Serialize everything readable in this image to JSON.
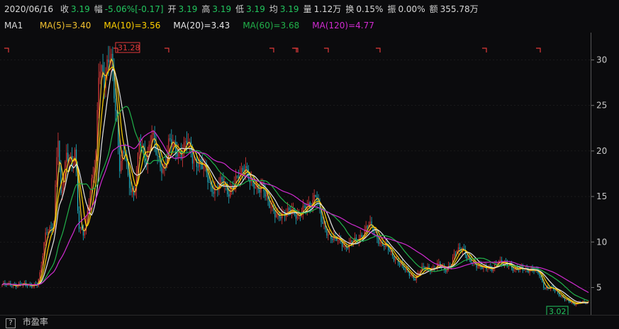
{
  "header": {
    "date": "2020/06/16",
    "items": [
      {
        "label": "收",
        "value": "3.19",
        "color": "#22c55e"
      },
      {
        "label": "幅",
        "value": "-5.06%[-0.17]",
        "color": "#22c55e"
      },
      {
        "label": "开",
        "value": "3.19",
        "color": "#22c55e"
      },
      {
        "label": "高",
        "value": "3.19",
        "color": "#22c55e"
      },
      {
        "label": "低",
        "value": "3.19",
        "color": "#22c55e"
      },
      {
        "label": "均",
        "value": "3.19",
        "color": "#22c55e"
      },
      {
        "label": "量",
        "value": "1.12万",
        "color": "#d8d8d8"
      },
      {
        "label": "换",
        "value": "0.15%",
        "color": "#d8d8d8"
      },
      {
        "label": "振",
        "value": "0.00%",
        "color": "#d8d8d8"
      },
      {
        "label": "额",
        "value": "355.78万",
        "color": "#d8d8d8"
      }
    ]
  },
  "ma_bar": {
    "title": "MA1",
    "entries": [
      {
        "text": "MA(5)=3.40",
        "color": "#f2c230"
      },
      {
        "text": "MA(10)=3.56",
        "color": "#ffd000"
      },
      {
        "text": "MA(20)=3.43",
        "color": "#e6e6e6"
      },
      {
        "text": "MA(60)=3.68",
        "color": "#21b14a"
      },
      {
        "text": "MA(120)=4.77",
        "color": "#d12bd1"
      }
    ]
  },
  "bottom_bar": {
    "help_icon": "question-icon",
    "label": "市盈率"
  },
  "colors": {
    "background": "#0b0b0d",
    "up": "#e33b3b",
    "down": "#21b6c8",
    "grid": "#2a2a2a"
  },
  "chart_data": {
    "type": "line",
    "ylim": [
      2,
      33
    ],
    "yticks": [
      5,
      10,
      15,
      20,
      25,
      30
    ],
    "annotations": [
      {
        "text": "31.28",
        "kind": "high"
      },
      {
        "text": "3.02",
        "kind": "low"
      }
    ],
    "price_series": {
      "name": "price",
      "points": [
        [
          0,
          5.3
        ],
        [
          0.06,
          5.3
        ],
        [
          0.065,
          6.5
        ],
        [
          0.075,
          11.5
        ],
        [
          0.088,
          11.5
        ],
        [
          0.095,
          22
        ],
        [
          0.1,
          15
        ],
        [
          0.11,
          20
        ],
        [
          0.12,
          18
        ],
        [
          0.125,
          20
        ],
        [
          0.13,
          12
        ],
        [
          0.14,
          11
        ],
        [
          0.15,
          15
        ],
        [
          0.16,
          20
        ],
        [
          0.165,
          30
        ],
        [
          0.175,
          27
        ],
        [
          0.185,
          31.28
        ],
        [
          0.195,
          24
        ],
        [
          0.2,
          18
        ],
        [
          0.21,
          20
        ],
        [
          0.215,
          17
        ],
        [
          0.225,
          15
        ],
        [
          0.235,
          21
        ],
        [
          0.245,
          19
        ],
        [
          0.255,
          22
        ],
        [
          0.265,
          19
        ],
        [
          0.275,
          18
        ],
        [
          0.285,
          21
        ],
        [
          0.295,
          20
        ],
        [
          0.305,
          20
        ],
        [
          0.315,
          21
        ],
        [
          0.325,
          19
        ],
        [
          0.335,
          19
        ],
        [
          0.345,
          18
        ],
        [
          0.355,
          16
        ],
        [
          0.365,
          16
        ],
        [
          0.375,
          16.5
        ],
        [
          0.385,
          15.5
        ],
        [
          0.395,
          16.5
        ],
        [
          0.405,
          17
        ],
        [
          0.415,
          18.5
        ],
        [
          0.425,
          16.5
        ],
        [
          0.435,
          15.5
        ],
        [
          0.445,
          16.5
        ],
        [
          0.455,
          14
        ],
        [
          0.465,
          13
        ],
        [
          0.475,
          13.2
        ],
        [
          0.485,
          13
        ],
        [
          0.495,
          13.5
        ],
        [
          0.505,
          13
        ],
        [
          0.515,
          13.5
        ],
        [
          0.525,
          14
        ],
        [
          0.535,
          15.5
        ],
        [
          0.545,
          12
        ],
        [
          0.555,
          11
        ],
        [
          0.565,
          10.5
        ],
        [
          0.575,
          10
        ],
        [
          0.585,
          9.5
        ],
        [
          0.595,
          10
        ],
        [
          0.605,
          10
        ],
        [
          0.615,
          11
        ],
        [
          0.625,
          12
        ],
        [
          0.635,
          11
        ],
        [
          0.645,
          10
        ],
        [
          0.655,
          9.5
        ],
        [
          0.665,
          8.5
        ],
        [
          0.675,
          8
        ],
        [
          0.685,
          7
        ],
        [
          0.695,
          6.5
        ],
        [
          0.705,
          6
        ],
        [
          0.715,
          7
        ],
        [
          0.725,
          7.2
        ],
        [
          0.735,
          7
        ],
        [
          0.745,
          7.5
        ],
        [
          0.755,
          7
        ],
        [
          0.765,
          7.5
        ],
        [
          0.775,
          9
        ],
        [
          0.785,
          9.5
        ],
        [
          0.795,
          8
        ],
        [
          0.805,
          7.5
        ],
        [
          0.815,
          7.5
        ],
        [
          0.825,
          7
        ],
        [
          0.835,
          7
        ],
        [
          0.845,
          8
        ],
        [
          0.855,
          7.5
        ],
        [
          0.865,
          7.5
        ],
        [
          0.875,
          7
        ],
        [
          0.885,
          7
        ],
        [
          0.895,
          7
        ],
        [
          0.905,
          7
        ],
        [
          0.915,
          6.5
        ],
        [
          0.925,
          5
        ],
        [
          0.935,
          5
        ],
        [
          0.945,
          4.5
        ],
        [
          0.955,
          4
        ],
        [
          0.965,
          3.5
        ],
        [
          0.975,
          3.1
        ],
        [
          0.985,
          3.5
        ],
        [
          0.995,
          3.3
        ]
      ]
    },
    "series": [
      {
        "name": "MA(5)",
        "color": "#f2c230",
        "smooth": 3
      },
      {
        "name": "MA(10)",
        "color": "#ffd000",
        "smooth": 6
      },
      {
        "name": "MA(20)",
        "color": "#e6e6e6",
        "smooth": 10
      },
      {
        "name": "MA(60)",
        "color": "#21b14a",
        "smooth": 22
      },
      {
        "name": "MA(120)",
        "color": "#d12bd1",
        "smooth": 40
      }
    ],
    "markers_top_count": 10
  }
}
